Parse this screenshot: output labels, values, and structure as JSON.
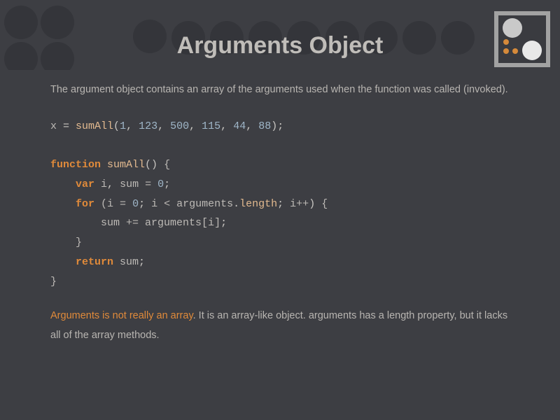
{
  "title": "Arguments Object",
  "intro": "The argument object contains an array of the arguments used when the function was called (invoked).",
  "code": {
    "l1_x": "x ",
    "l1_eq": "= ",
    "l1_fn": "sumAll",
    "l1_paren_open": "(",
    "l1_n1": "1",
    "l1_c": ", ",
    "l1_n2": "123",
    "l1_n3": "500",
    "l1_n4": "115",
    "l1_n5": "44",
    "l1_n6": "88",
    "l1_paren_close": ")",
    "l1_semi": ";",
    "l3_kw": "function",
    "l3_sp": " ",
    "l3_fn": "sumAll",
    "l3_parens": "()",
    "l3_brace": " {",
    "l4_indent": "    ",
    "l4_var": "var",
    "l4_rest_a": " i",
    "l4_comma": ", ",
    "l4_rest_b": "sum = ",
    "l4_zero": "0",
    "l4_semi": ";",
    "l5_indent": "    ",
    "l5_for": "for",
    "l5_open": " (",
    "l5_a": "i = ",
    "l5_zero": "0",
    "l5_semi1": ";",
    "l5_b": " i < arguments",
    "l5_dot": ".",
    "l5_length": "length",
    "l5_semi2": ";",
    "l5_c": " i++",
    "l5_close": ")",
    "l5_brace": " {",
    "l6_indent": "        ",
    "l6_a": "sum += arguments[",
    "l6_i": "i",
    "l6_b": "]",
    "l6_semi": ";",
    "l7_indent": "    ",
    "l7_brace": "}",
    "l8_indent": "    ",
    "l8_return": "return",
    "l8_rest": " sum",
    "l8_semi": ";",
    "l9_brace": "}"
  },
  "note": {
    "highlight": "Arguments is not really an array",
    "rest": ". It is an array-like object. arguments has a length property, but it lacks all of the array methods."
  }
}
